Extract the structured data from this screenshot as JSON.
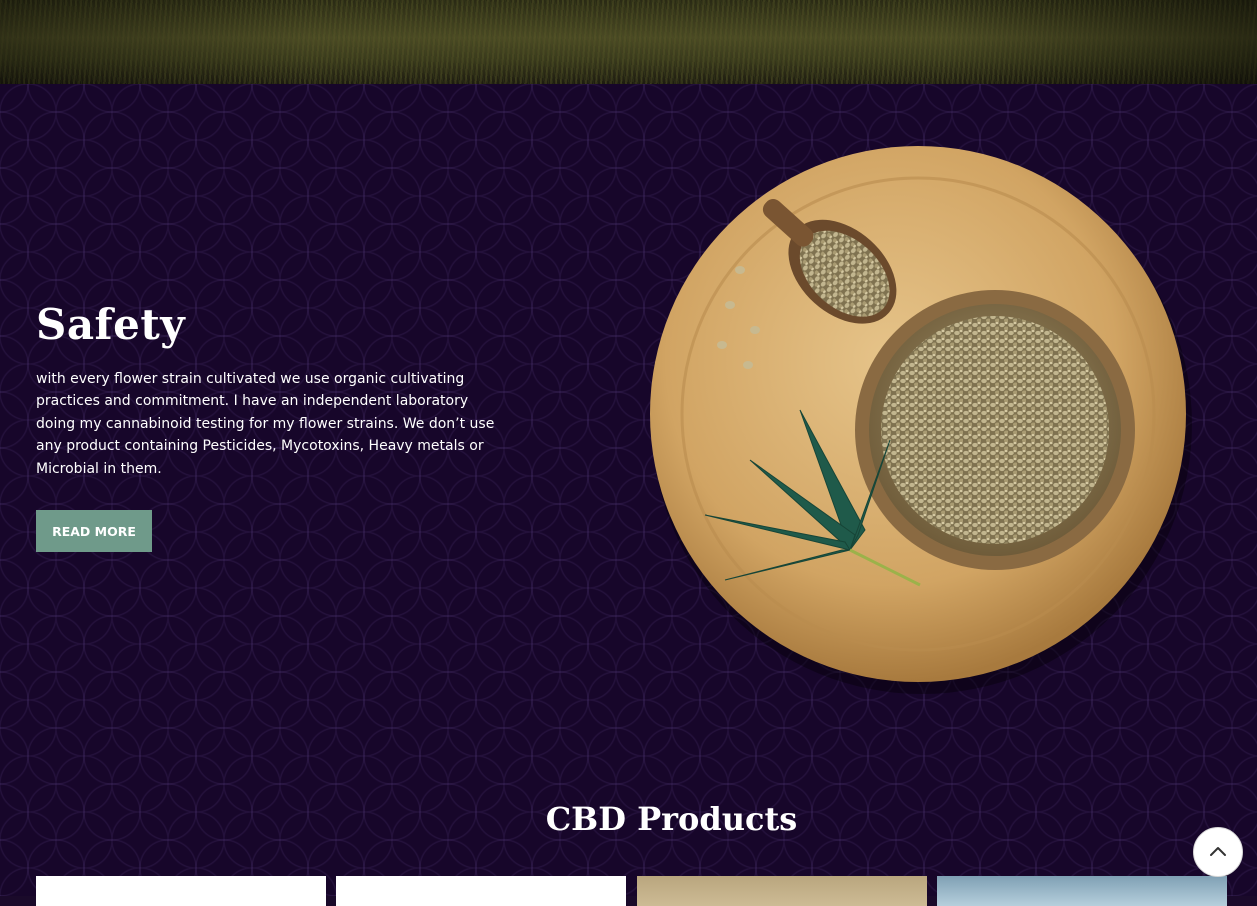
{
  "safety": {
    "title": "Safety",
    "description": "with every flower strain cultivated we use organic cultivating practices and commitment. I have an independent laboratory doing my cannabinoid testing for my flower strains. We don’t use any product containing Pesticides, Mycotoxins, Heavy metals or Microbial in them.",
    "button_label": "READ MORE"
  },
  "products": {
    "title": "CBD Products"
  },
  "icons": {
    "scroll_top": "chevron-up-icon",
    "plate": "hemp-seeds-plate-image"
  },
  "colors": {
    "section_bg": "#17062a",
    "button_bg": "#6f9a8a",
    "text": "#ffffff"
  }
}
